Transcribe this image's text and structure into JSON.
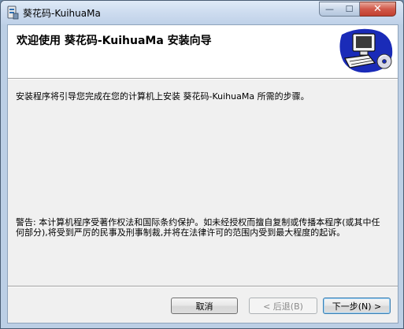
{
  "window": {
    "title": "葵花码-KuihuaMa",
    "controls": {
      "minimize_glyph": "—",
      "maximize_glyph": "☐",
      "close_glyph": "✕"
    }
  },
  "banner": {
    "title": "欢迎使用 葵花码-KuihuaMa 安装向导",
    "art_icon": "computer-setup-icon"
  },
  "body": {
    "intro": "安装程序将引导您完成在您的计算机上安装 葵花码-KuihuaMa 所需的步骤。",
    "warning": "警告: 本计算机程序受著作权法和国际条约保护。如未经授权而擅自复制或传播本程序(或其中任何部分),将受到严厉的民事及刑事制裁,并将在法律许可的范围内受到最大程度的起诉。"
  },
  "buttons": {
    "cancel": "取消",
    "back": "< 后退(B)",
    "next": "下一步(N) >"
  },
  "colors": {
    "close_button": "#c8493a",
    "default_button_border": "#3c7fb1"
  }
}
